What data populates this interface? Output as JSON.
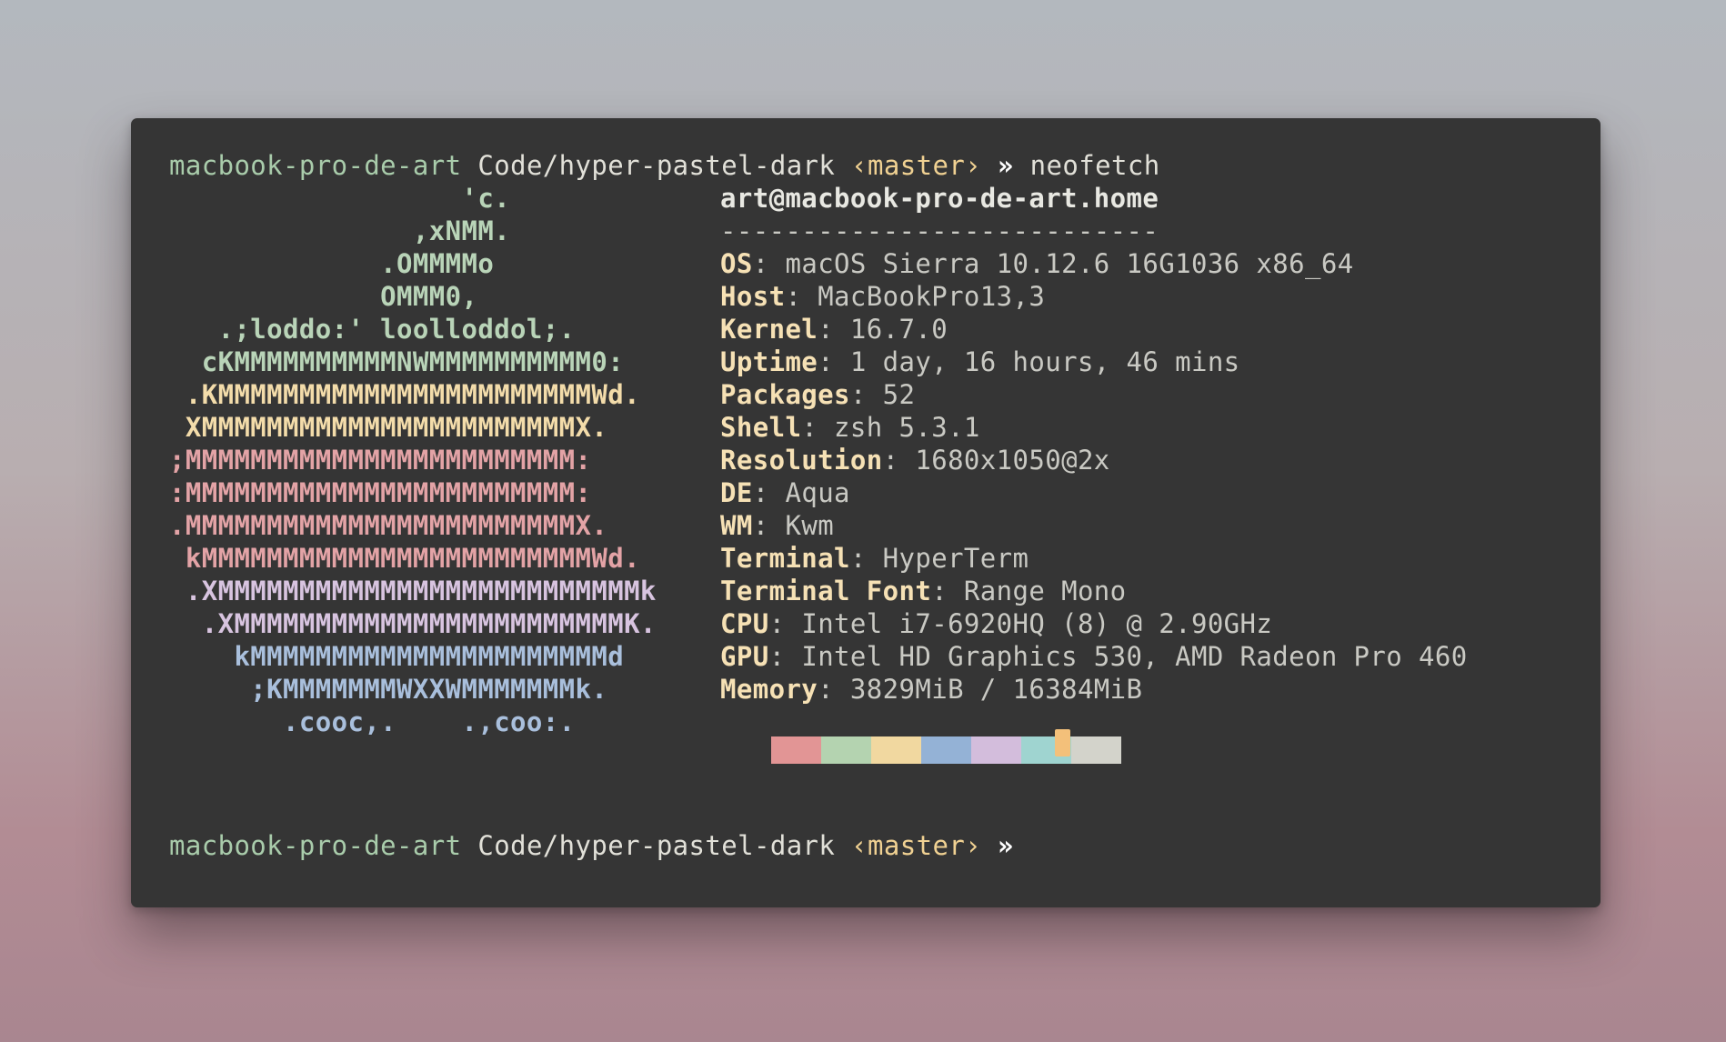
{
  "prompt1": {
    "host": "macbook-pro-de-art",
    "path": "Code/hyper-pastel-dark",
    "branch": "‹master›",
    "arrow": "»",
    "command": "neofetch"
  },
  "ascii_logo": [
    "                  'c.",
    "               ,xNMM.",
    "             .OMMMMo",
    "             OMMM0,",
    "   .;loddo:' loolloddol;.",
    "  cKMMMMMMMMMMNWMMMMMMMMMM0:",
    " .KMMMMMMMMMMMMMMMMMMMMMMMWd.",
    " XMMMMMMMMMMMMMMMMMMMMMMMX.",
    ";MMMMMMMMMMMMMMMMMMMMMMMM:",
    ":MMMMMMMMMMMMMMMMMMMMMMMM:",
    ".MMMMMMMMMMMMMMMMMMMMMMMMX.",
    " kMMMMMMMMMMMMMMMMMMMMMMMMWd.",
    " .XMMMMMMMMMMMMMMMMMMMMMMMMMMk",
    "  .XMMMMMMMMMMMMMMMMMMMMMMMMK.",
    "    kMMMMMMMMMMMMMMMMMMMMMMd",
    "     ;KMMMMMMMWXXWMMMMMMMk.",
    "       .cooc,.    .,coo:."
  ],
  "info": {
    "title": "art@macbook-pro-de-art.home",
    "separator": "---------------------------",
    "rows": [
      {
        "key": "OS",
        "value": "macOS Sierra 10.12.6 16G1036 x86_64"
      },
      {
        "key": "Host",
        "value": "MacBookPro13,3"
      },
      {
        "key": "Kernel",
        "value": "16.7.0"
      },
      {
        "key": "Uptime",
        "value": "1 day, 16 hours, 46 mins"
      },
      {
        "key": "Packages",
        "value": "52"
      },
      {
        "key": "Shell",
        "value": "zsh 5.3.1"
      },
      {
        "key": "Resolution",
        "value": "1680x1050@2x"
      },
      {
        "key": "DE",
        "value": "Aqua"
      },
      {
        "key": "WM",
        "value": "Kwm"
      },
      {
        "key": "Terminal",
        "value": "HyperTerm"
      },
      {
        "key": "Terminal Font",
        "value": "Range Mono"
      },
      {
        "key": "CPU",
        "value": "Intel i7-6920HQ (8) @ 2.90GHz"
      },
      {
        "key": "GPU",
        "value": "Intel HD Graphics 530, AMD Radeon Pro 460"
      },
      {
        "key": "Memory",
        "value": "3829MiB / 16384MiB"
      }
    ],
    "separator_char": ": "
  },
  "palette": [
    "#e29595",
    "#b4d3b0",
    "#f1d8a0",
    "#94b2d6",
    "#d3bddc",
    "#9fd4d0",
    "#d3d3cb"
  ],
  "cursor_color": "#f3c07a",
  "prompt2": {
    "host": "macbook-pro-de-art",
    "path": "Code/hyper-pastel-dark",
    "branch": "‹master›",
    "arrow": "»"
  }
}
